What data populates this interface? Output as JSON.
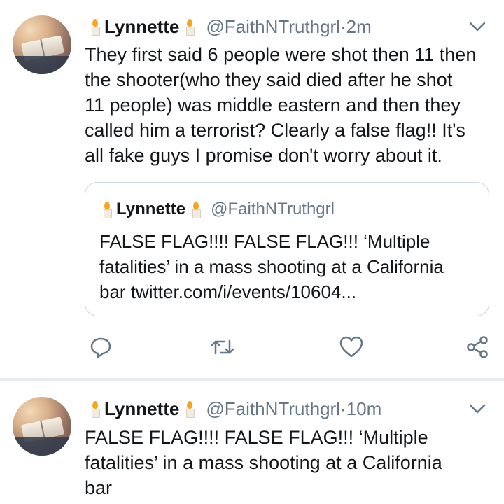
{
  "colors": {
    "text": "#14171a",
    "secondary": "#657786",
    "border": "#ccd6dd",
    "divider": "#e6ecf0",
    "flame": "#f4a623"
  },
  "tweets": [
    {
      "name": "Lynnette",
      "handle": "@FaithNTruthgrl",
      "separator": " · ",
      "time": "2m",
      "text": "They first said 6 people were shot then 11 then\nthe shooter(who they said died after he shot\n11 people) was middle eastern and then they\ncalled him a terrorist? Clearly a false flag!! It's\nall fake guys I promise don't worry about it.",
      "quoted": {
        "name": "Lynnette",
        "handle": "@FaithNTruthgrl",
        "text": "FALSE FLAG!!!! FALSE FLAG!!!  ‘Multiple\nfatalities’ in a mass shooting at a California\nbar  twitter.com/i/events/10604..."
      },
      "actions": [
        "reply-icon",
        "retweet-icon",
        "like-icon",
        "share-icon"
      ]
    },
    {
      "name": "Lynnette",
      "handle": "@FaithNTruthgrl",
      "separator": " · ",
      "time": "10m",
      "text": "FALSE FLAG!!!! FALSE FLAG!!!  ‘Multiple\nfatalities’ in a mass shooting at a California\nbar"
    }
  ]
}
